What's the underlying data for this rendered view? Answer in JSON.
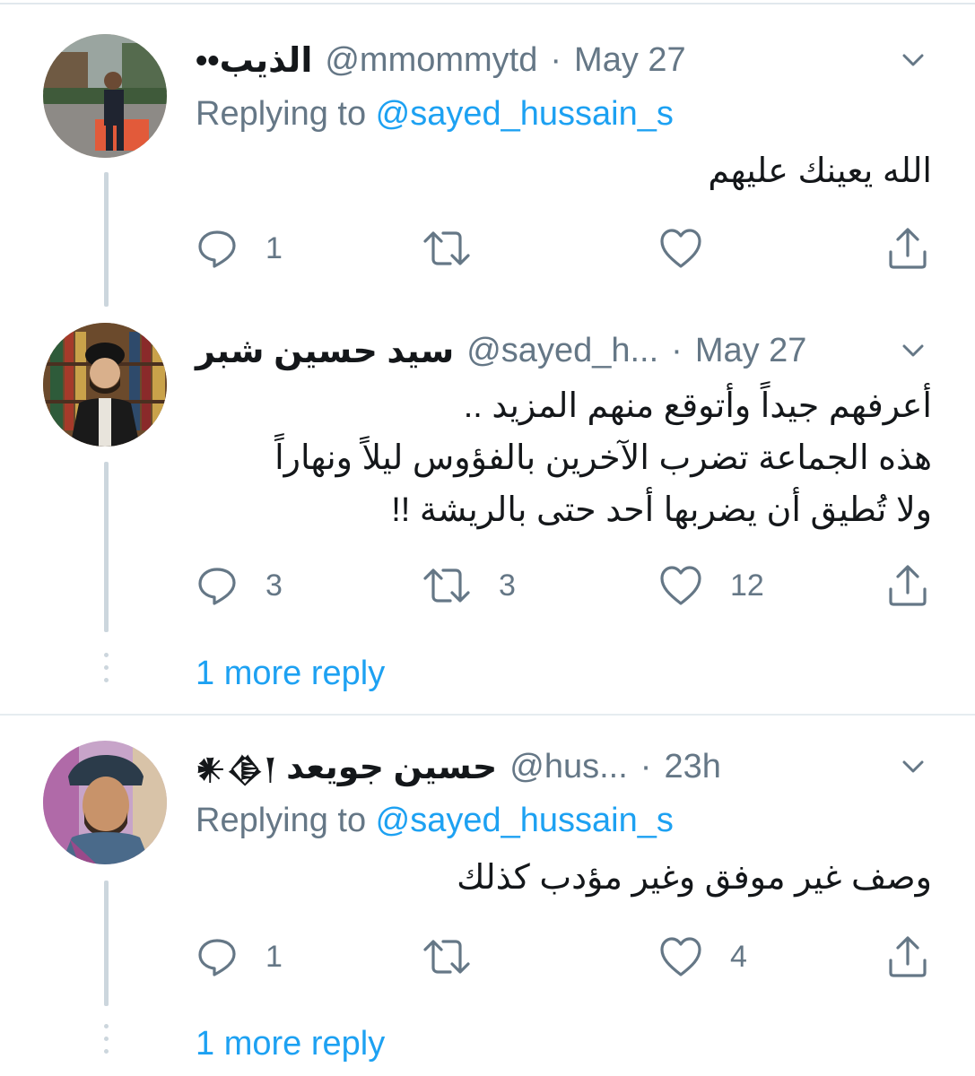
{
  "tweets": [
    {
      "name": "الذيب••",
      "handle": "@mmommytd",
      "sep": "·",
      "time": "May 27",
      "replying_prefix": "Replying to ",
      "replying_to": "@sayed_hussain_s",
      "text_lines": [
        "الله يعينك عليهم"
      ],
      "reply_count": "1",
      "retweet_count": "",
      "like_count": ""
    },
    {
      "name": "سيد حسين شبر",
      "handle": "@sayed_h...",
      "sep": "·",
      "time": "May 27",
      "text_lines": [
        "أعرفهم جيداً وأتوقع منهم المزيد ..",
        "هذه الجماعة تضرب الآخرين بالفؤوس ليلاً ونهاراً",
        "ولا تُطيق أن يضربها أحد حتى بالريشة !!"
      ],
      "reply_count": "3",
      "retweet_count": "3",
      "like_count": "12",
      "more_reply": "1 more reply"
    },
    {
      "name": "حسين جويعد",
      "name_badge": "𒀭𒆠𒁹",
      "handle": "@hus...",
      "sep": "·",
      "time": "23h",
      "replying_prefix": "Replying to ",
      "replying_to": "@sayed_hussain_s",
      "text_lines": [
        "وصف غير موفق وغير مؤدب كذلك"
      ],
      "reply_count": "1",
      "retweet_count": "",
      "like_count": "4",
      "more_reply": "1 more reply"
    }
  ],
  "icons": {
    "reply": "reply-icon",
    "retweet": "retweet-icon",
    "like": "heart-icon",
    "share": "share-icon",
    "menu": "chevron-down-icon"
  },
  "colors": {
    "link": "#1da1f2",
    "muted": "#657786",
    "thread_line": "#ccd6dd"
  }
}
